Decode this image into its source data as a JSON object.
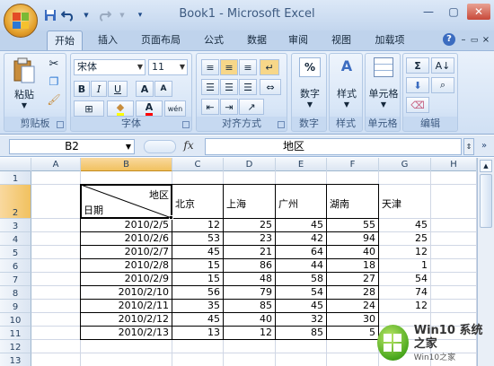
{
  "window": {
    "title": "Book1 - Microsoft Excel"
  },
  "quick_access": {
    "save_icon": "save-icon",
    "undo_icon": "undo-icon",
    "redo_icon": "redo-icon",
    "customize_icon": "customize-qat-icon"
  },
  "tabs": [
    "开始",
    "插入",
    "页面布局",
    "公式",
    "数据",
    "审阅",
    "视图",
    "加载项"
  ],
  "active_tab": "开始",
  "ribbon": {
    "clipboard": {
      "label": "剪贴板",
      "paste": "粘贴"
    },
    "font": {
      "label": "字体",
      "name": "宋体",
      "size": "11",
      "bold": "B",
      "italic": "I",
      "underline": "U",
      "grow": "A",
      "shrink": "A",
      "color_letter": "A",
      "phonetic": "wén"
    },
    "alignment": {
      "label": "对齐方式"
    },
    "number": {
      "label": "数字",
      "button": "数字",
      "percent": "%"
    },
    "styles": {
      "label": "样式",
      "button": "样式"
    },
    "cells": {
      "label": "单元格",
      "button": "单元格"
    },
    "editing": {
      "label": "编辑",
      "sum": "Σ"
    }
  },
  "formula_bar": {
    "name_box": "B2",
    "fx": "fx",
    "value": "地区"
  },
  "sheet": {
    "columns": [
      "A",
      "B",
      "C",
      "D",
      "E",
      "F",
      "G",
      "H"
    ],
    "selected_column": "B",
    "rows": [
      "1",
      "2",
      "3",
      "4",
      "5",
      "6",
      "7",
      "8",
      "9",
      "10",
      "11",
      "12",
      "13"
    ],
    "selected_row": "2",
    "header_cell": {
      "top_right": "地区",
      "bottom_left": "日期"
    },
    "regions": [
      "北京",
      "上海",
      "广州",
      "湖南",
      "天津"
    ],
    "data": [
      {
        "date": "2010/2/5",
        "values": [
          "12",
          "25",
          "45",
          "55",
          "45"
        ]
      },
      {
        "date": "2010/2/6",
        "values": [
          "53",
          "23",
          "42",
          "94",
          "25"
        ]
      },
      {
        "date": "2010/2/7",
        "values": [
          "45",
          "21",
          "64",
          "40",
          "12"
        ]
      },
      {
        "date": "2010/2/8",
        "values": [
          "15",
          "86",
          "44",
          "18",
          "1"
        ]
      },
      {
        "date": "2010/2/9",
        "values": [
          "15",
          "48",
          "58",
          "27",
          "54"
        ]
      },
      {
        "date": "2010/2/10",
        "values": [
          "56",
          "79",
          "54",
          "28",
          "74"
        ]
      },
      {
        "date": "2010/2/11",
        "values": [
          "35",
          "85",
          "45",
          "24",
          "12"
        ]
      },
      {
        "date": "2010/2/12",
        "values": [
          "45",
          "40",
          "32",
          "30",
          ""
        ]
      },
      {
        "date": "2010/2/13",
        "values": [
          "13",
          "12",
          "85",
          "5",
          ""
        ]
      }
    ]
  },
  "watermark": {
    "brand": "Win10",
    "name": "系统之家",
    "sub": "Win10之家"
  },
  "colors": {
    "accent": "#1d4a88",
    "selected_header": "#f1c15f",
    "ribbon": "#d0e0f4",
    "watermark_green": "#4aa81d"
  }
}
